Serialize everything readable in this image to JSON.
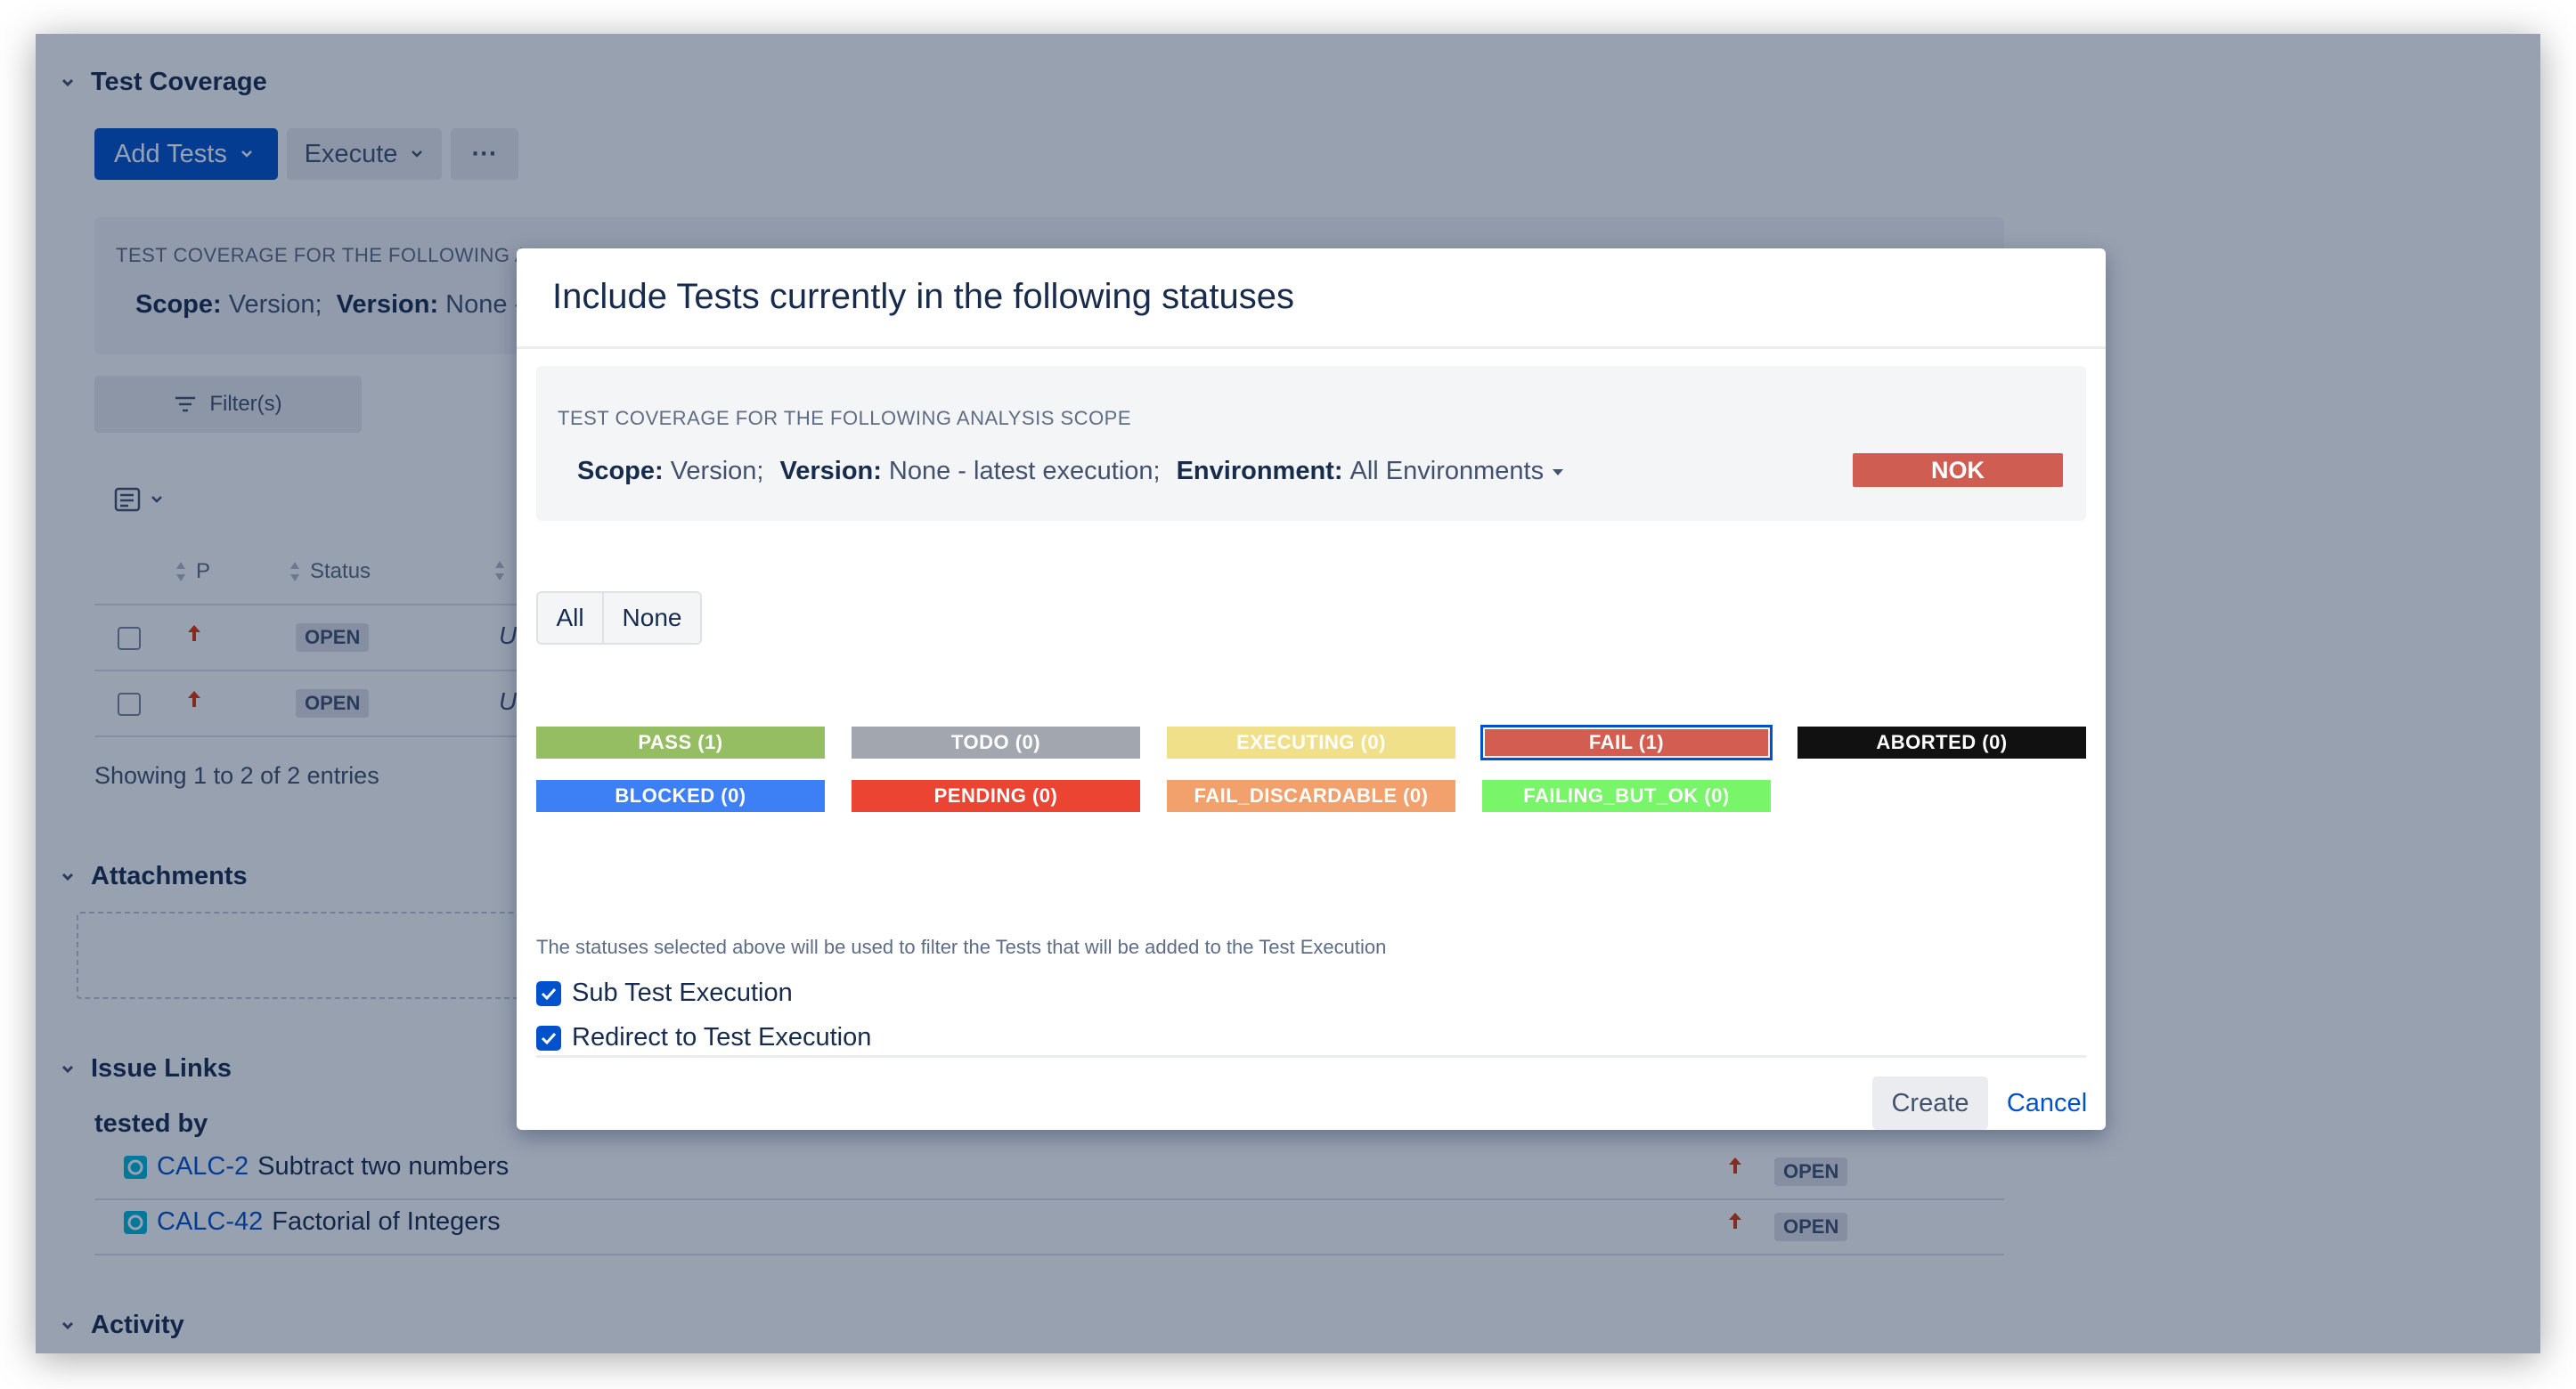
{
  "test_coverage": {
    "title": "Test Coverage",
    "add_tests_label": "Add Tests",
    "execute_label": "Execute",
    "more_label": "···",
    "scope_caption": "TEST COVERAGE FOR THE FOLLOWING A",
    "scope_label": "Scope:",
    "scope_value": "Version;",
    "version_label": "Version:",
    "version_value": "None -",
    "filters_label": "Filter(s)",
    "col_p": "P",
    "col_status": "Status",
    "rows": [
      {
        "status": "OPEN",
        "summary": "U"
      },
      {
        "status": "OPEN",
        "summary": "U"
      }
    ],
    "showing": "Showing 1 to 2 of 2 entries"
  },
  "attachments": {
    "title": "Attachments"
  },
  "issue_links": {
    "title": "Issue Links",
    "group_label": "tested by",
    "items": [
      {
        "key": "CALC-2",
        "summary": "Subtract two numbers",
        "status": "OPEN"
      },
      {
        "key": "CALC-42",
        "summary": "Factorial of Integers",
        "status": "OPEN"
      }
    ]
  },
  "activity": {
    "title": "Activity"
  },
  "modal": {
    "title": "Include Tests currently in the following statuses",
    "scope_caption": "TEST COVERAGE FOR THE FOLLOWING ANALYSIS SCOPE",
    "scope_label": "Scope:",
    "scope_value": "Version;",
    "version_label": "Version:",
    "version_value": "None - latest execution;",
    "environment_label": "Environment:",
    "environment_value": "All Environments",
    "overall_status": "NOK",
    "all_label": "All",
    "none_label": "None",
    "statuses": [
      {
        "label": "PASS (1)",
        "color": "#95bd61",
        "selected": false
      },
      {
        "label": "TODO (0)",
        "color": "#a2a6ae",
        "selected": false
      },
      {
        "label": "EXECUTING (0)",
        "color": "#f1e08a",
        "selected": false
      },
      {
        "label": "FAIL (1)",
        "color": "#d45d52",
        "selected": true
      },
      {
        "label": "ABORTED (0)",
        "color": "#111111",
        "selected": false
      },
      {
        "label": "BLOCKED (0)",
        "color": "#3d80f6",
        "selected": false
      },
      {
        "label": "PENDING (0)",
        "color": "#ec4432",
        "selected": false
      },
      {
        "label": "FAIL_DISCARDABLE (0)",
        "color": "#f2a16c",
        "selected": false
      },
      {
        "label": "FAILING_BUT_OK (0)",
        "color": "#79f56a",
        "selected": false
      }
    ],
    "hint": "The statuses selected above will be used to filter the Tests that will be added to the Test Execution",
    "sub_test_execution_label": "Sub Test Execution",
    "redirect_label": "Redirect to Test Execution",
    "create_label": "Create",
    "cancel_label": "Cancel",
    "nok_color": "#cf5d51"
  }
}
